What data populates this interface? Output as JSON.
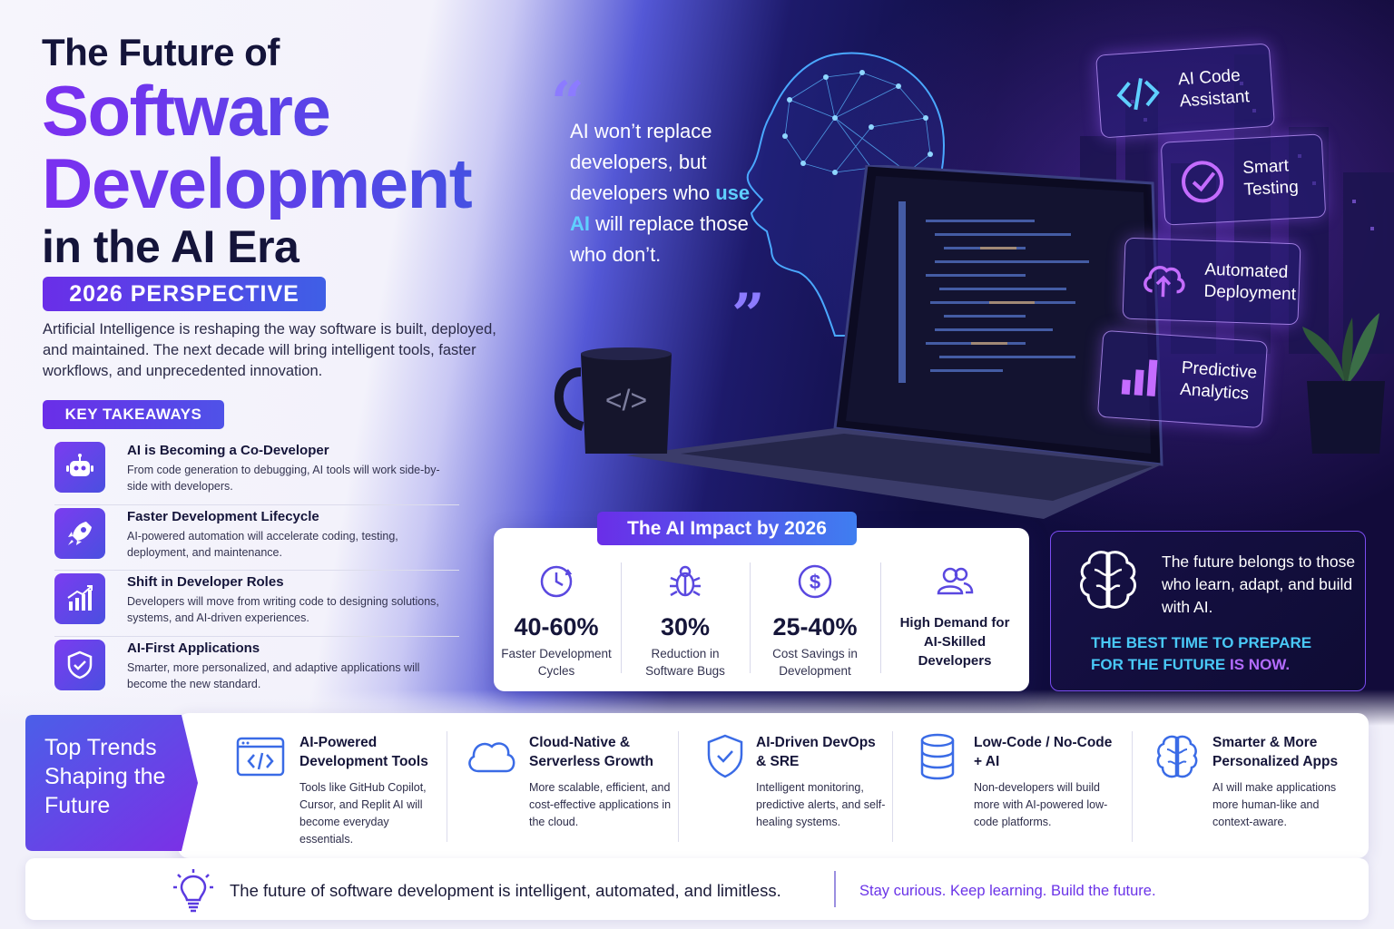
{
  "header": {
    "line1": "The Future of",
    "line2": "Software",
    "line3": "Development",
    "line4": "in the AI Era",
    "badge": "2026 PERSPECTIVE",
    "intro": "Artificial Intelligence is reshaping the way software is built, deployed, and maintained. The next decade will bring intelligent tools, faster workflows, and unprecedented innovation."
  },
  "takeaways": {
    "badge": "KEY TAKEAWAYS",
    "items": [
      {
        "title": "AI is Becoming a Co-Developer",
        "desc": "From code generation to debugging, AI tools will work side-by-side with developers.",
        "icon": "robot-icon"
      },
      {
        "title": "Faster Development Lifecycle",
        "desc": "AI-powered automation will accelerate coding, testing, deployment, and maintenance.",
        "icon": "rocket-icon"
      },
      {
        "title": "Shift in Developer Roles",
        "desc": "Developers will move from writing code to designing solutions, systems, and AI-driven experiences.",
        "icon": "growth-chart-icon"
      },
      {
        "title": "AI-First Applications",
        "desc": "Smarter, more personalized, and adaptive applications will become the new standard.",
        "icon": "shield-check-icon"
      }
    ]
  },
  "quote": {
    "part1": "AI won’t replace developers, but developers who",
    "highlight": "use AI",
    "part2": "will replace those who don’t.",
    "open_mark": "“",
    "close_mark": "”"
  },
  "features": [
    {
      "label": "AI Code Assistant",
      "icon": "code-brackets-icon"
    },
    {
      "label": "Smart Testing",
      "icon": "check-circle-icon"
    },
    {
      "label": "Automated Deployment",
      "icon": "cloud-upload-icon"
    },
    {
      "label": "Predictive Analytics",
      "icon": "bar-chart-icon"
    }
  ],
  "mug_glyph": "</>",
  "impact": {
    "title": "The AI Impact by 2026",
    "stats": [
      {
        "value": "40-60%",
        "label1": "Faster Development",
        "label2": "Cycles",
        "icon": "clock-icon"
      },
      {
        "value": "30%",
        "label1": "Reduction in",
        "label2": "Software Bugs",
        "icon": "bug-icon"
      },
      {
        "value": "25-40%",
        "label1": "Cost Savings in",
        "label2": "Development",
        "icon": "dollar-icon"
      }
    ],
    "demand": {
      "line1": "High Demand for",
      "line2": "AI-Skilled",
      "line3": "Developers",
      "icon": "users-icon"
    }
  },
  "future": {
    "text": "The future belongs to those who learn, adapt, and build with AI.",
    "cta1": "THE BEST TIME TO PREPARE",
    "cta2_a": "FOR THE FUTURE",
    "cta2_b": "IS NOW."
  },
  "trends": {
    "heading": "Top Trends Shaping the Future",
    "items": [
      {
        "title": "AI-Powered Development Tools",
        "desc": "Tools like GitHub Copilot, Cursor, and Replit AI will become everyday essentials.",
        "icon": "code-window-icon"
      },
      {
        "title": "Cloud-Native & Serverless Growth",
        "desc": "More scalable, efficient, and cost-effective applications in the cloud.",
        "icon": "cloud-icon"
      },
      {
        "title": "AI-Driven DevOps & SRE",
        "desc": "Intelligent monitoring, predictive alerts, and self-healing systems.",
        "icon": "shield-check-icon"
      },
      {
        "title": "Low-Code / No-Code + AI",
        "desc": "Non-developers will build more with AI-powered low-code platforms.",
        "icon": "database-icon"
      },
      {
        "title": "Smarter & More Personalized Apps",
        "desc": "AI will make applications more human-like and context-aware.",
        "icon": "brain-icon"
      }
    ]
  },
  "footer": {
    "main": "The future of software development is intelligent, automated, and limitless.",
    "cta": "Stay curious. Keep learning. Build the future."
  },
  "colors": {
    "accent_purple": "#6a2ee8",
    "accent_blue": "#3f5fe6",
    "cyan": "#49c8f6"
  }
}
